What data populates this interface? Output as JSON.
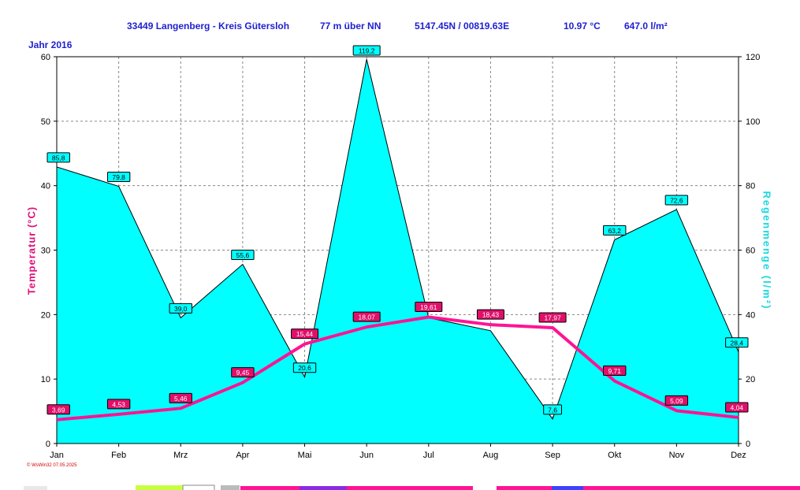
{
  "header": {
    "station": "33449 Langenberg - Kreis Gütersloh",
    "altitude": "77 m über NN",
    "coords": "5147.45N / 00819.63E",
    "mean_temp": "10.97 °C",
    "total_rain": "647.0 l/m²",
    "year_label": "Jahr  2016"
  },
  "credit": "© WsWin32  07.05.2025",
  "colors": {
    "rain_fill": "#00ffff",
    "temp_line": "#ff1493",
    "title": "#1f1fd0",
    "right_axis": "#18d8e0"
  },
  "chart_data": {
    "type": "area",
    "categories": [
      "Jan",
      "Feb",
      "Mrz",
      "Apr",
      "Mai",
      "Jun",
      "Jul",
      "Aug",
      "Sep",
      "Okt",
      "Nov",
      "Dez"
    ],
    "ylabel_left": "Temperatur  (°C)",
    "ylabel_right": "Regenmenge  (l/m²)",
    "ylim_left": [
      0,
      60
    ],
    "ylim_right": [
      0,
      120
    ],
    "yticks_left": [
      0,
      10,
      20,
      30,
      40,
      50,
      60
    ],
    "yticks_right": [
      0,
      20,
      40,
      60,
      80,
      100,
      120
    ],
    "grid": true,
    "series": [
      {
        "name": "Regenmenge",
        "axis": "right",
        "kind": "area",
        "values": [
          85.8,
          79.8,
          39.0,
          55.6,
          20.6,
          119.2,
          39.0,
          35.0,
          7.6,
          63.2,
          72.6,
          28.4
        ],
        "labels": [
          "85,8",
          "79,8",
          "39,0",
          "55,6",
          "20,6",
          "119,2",
          "",
          "",
          "7,6",
          "63,2",
          "72,6",
          "28,4"
        ]
      },
      {
        "name": "Temperatur",
        "axis": "left",
        "kind": "line",
        "values": [
          3.69,
          4.53,
          5.46,
          9.45,
          15.44,
          18.07,
          19.61,
          18.43,
          17.97,
          9.71,
          5.09,
          4.04
        ],
        "labels": [
          "3,69",
          "4,53",
          "5,46",
          "9,45",
          "15,44",
          "18,07",
          "19,61",
          "18,43",
          "17,97",
          "9,71",
          "5,09",
          "4,04"
        ]
      }
    ]
  }
}
